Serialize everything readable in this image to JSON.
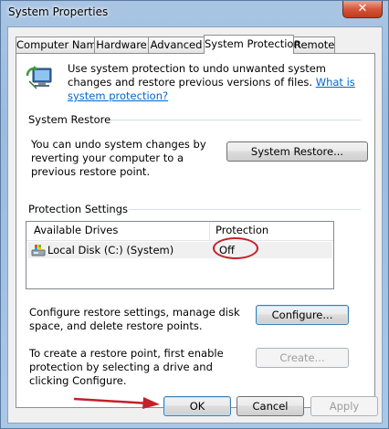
{
  "window": {
    "title": "System Properties",
    "close_label": "✕"
  },
  "tabs": [
    {
      "label": "Computer Name",
      "active": false
    },
    {
      "label": "Hardware",
      "active": false
    },
    {
      "label": "Advanced",
      "active": false
    },
    {
      "label": "System Protection",
      "active": true
    },
    {
      "label": "Remote",
      "active": false
    }
  ],
  "intro": {
    "text": "Use system protection to undo unwanted system changes and restore previous versions of files.",
    "link": "What is system protection?"
  },
  "system_restore": {
    "heading": "System Restore",
    "description": "You can undo system changes by reverting your computer to a previous restore point.",
    "button_label": "System Restore..."
  },
  "protection_settings": {
    "heading": "Protection Settings",
    "columns": [
      "Available Drives",
      "Protection"
    ],
    "rows": [
      {
        "drive": "Local Disk (C:) (System)",
        "protection": "Off"
      }
    ],
    "configure_text": "Configure restore settings, manage disk space, and delete restore points.",
    "configure_button": "Configure...",
    "create_text": "To create a restore point, first enable protection by selecting a drive and clicking Configure.",
    "create_button": "Create..."
  },
  "footer": {
    "ok_label": "OK",
    "cancel_label": "Cancel",
    "apply_label": "Apply"
  },
  "annotations": {
    "highlight_color": "#c4202a"
  }
}
